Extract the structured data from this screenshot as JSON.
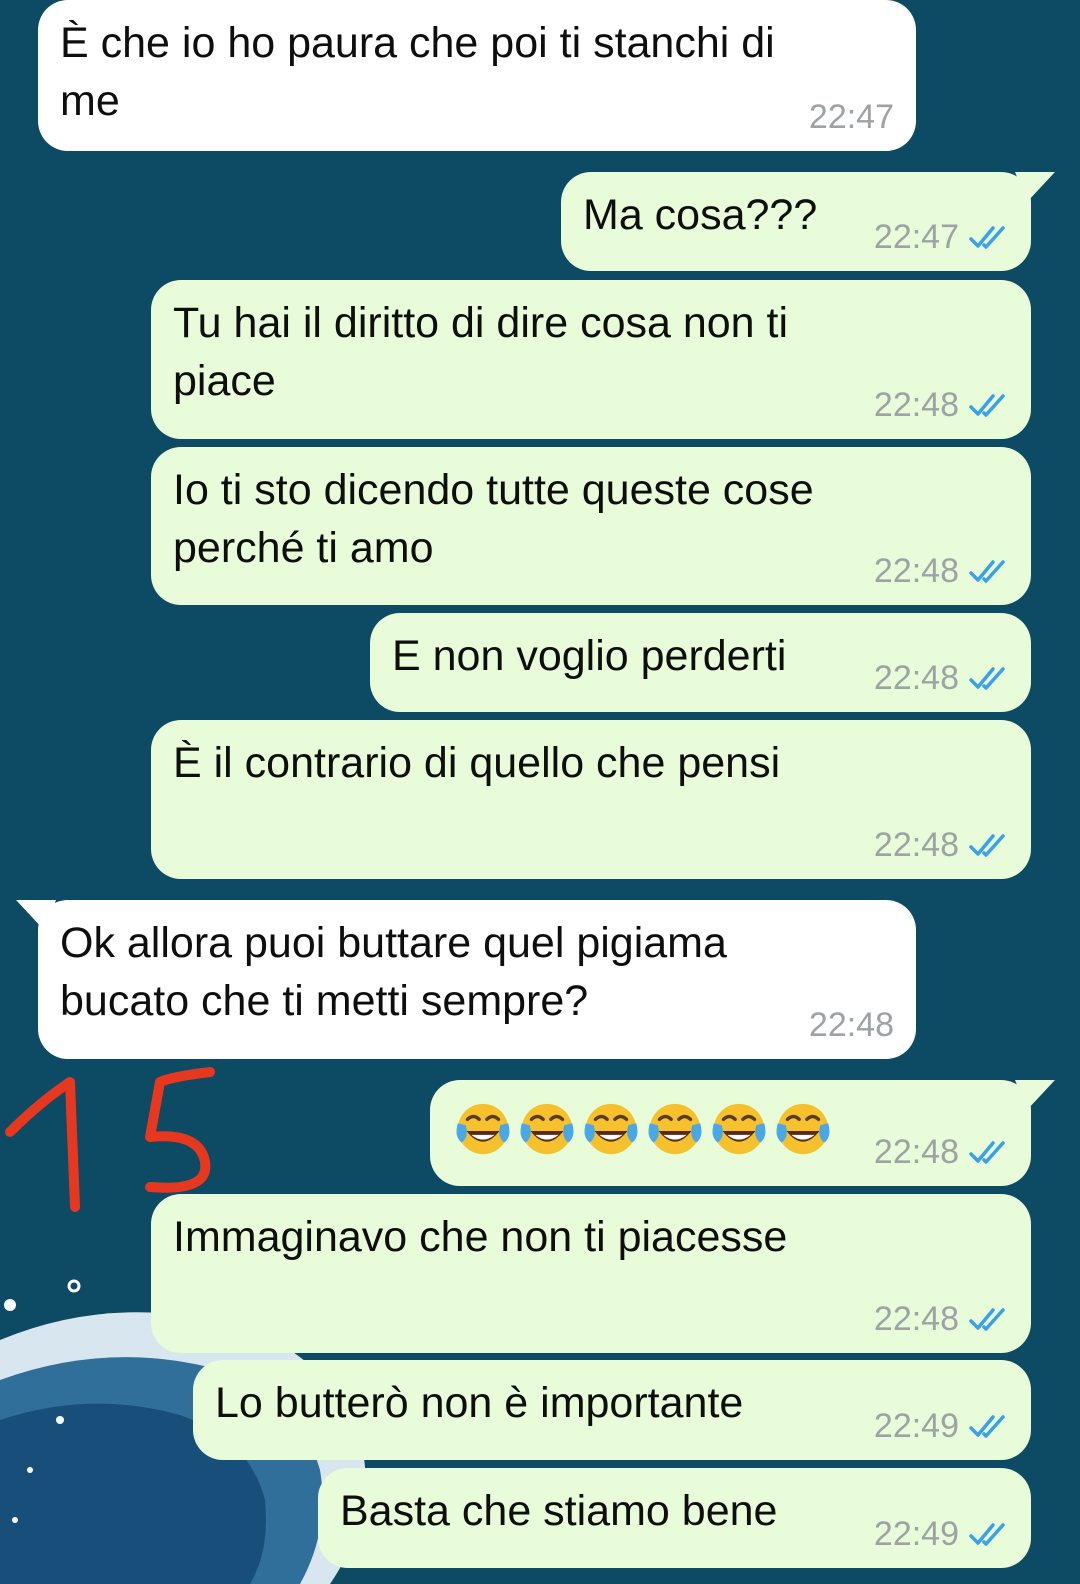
{
  "messages": [
    {
      "direction": "in",
      "text": "È che io ho paura che poi ti stanchi di\nme",
      "time": "22:47"
    },
    {
      "direction": "out",
      "text": "Ma cosa???",
      "time": "22:47",
      "read": true
    },
    {
      "direction": "out",
      "text": "Tu hai il diritto di dire cosa non ti\npiace",
      "time": "22:48",
      "read": true
    },
    {
      "direction": "out",
      "text": "Io ti sto dicendo tutte queste cose\nperché ti amo",
      "time": "22:48",
      "read": true
    },
    {
      "direction": "out",
      "text": "E non voglio perderti",
      "time": "22:48",
      "read": true
    },
    {
      "direction": "out",
      "text": "È il contrario di quello che pensi",
      "time": "22:48",
      "read": true
    },
    {
      "direction": "in",
      "text": "Ok allora puoi buttare quel pigiama\nbucato che ti metti sempre?",
      "time": "22:48"
    },
    {
      "direction": "out",
      "emoji": [
        "face-with-tears-of-joy",
        "face-with-tears-of-joy",
        "face-with-tears-of-joy",
        "face-with-tears-of-joy",
        "face-with-tears-of-joy",
        "face-with-tears-of-joy"
      ],
      "time": "22:48",
      "read": true
    },
    {
      "direction": "out",
      "text": "Immaginavo che non ti piacesse",
      "time": "22:48",
      "read": true
    },
    {
      "direction": "out",
      "text": "Lo butterò non è importante",
      "time": "22:49",
      "read": true
    },
    {
      "direction": "out",
      "text": "Basta che stiamo bene",
      "time": "22:49",
      "read": true
    }
  ],
  "annotation": {
    "text": "15",
    "color": "#e8371f"
  },
  "colors": {
    "background": "#0d4a63",
    "incoming": "#ffffff",
    "outgoing": "#e8fcd9",
    "read_tick": "#3aa0e8"
  }
}
